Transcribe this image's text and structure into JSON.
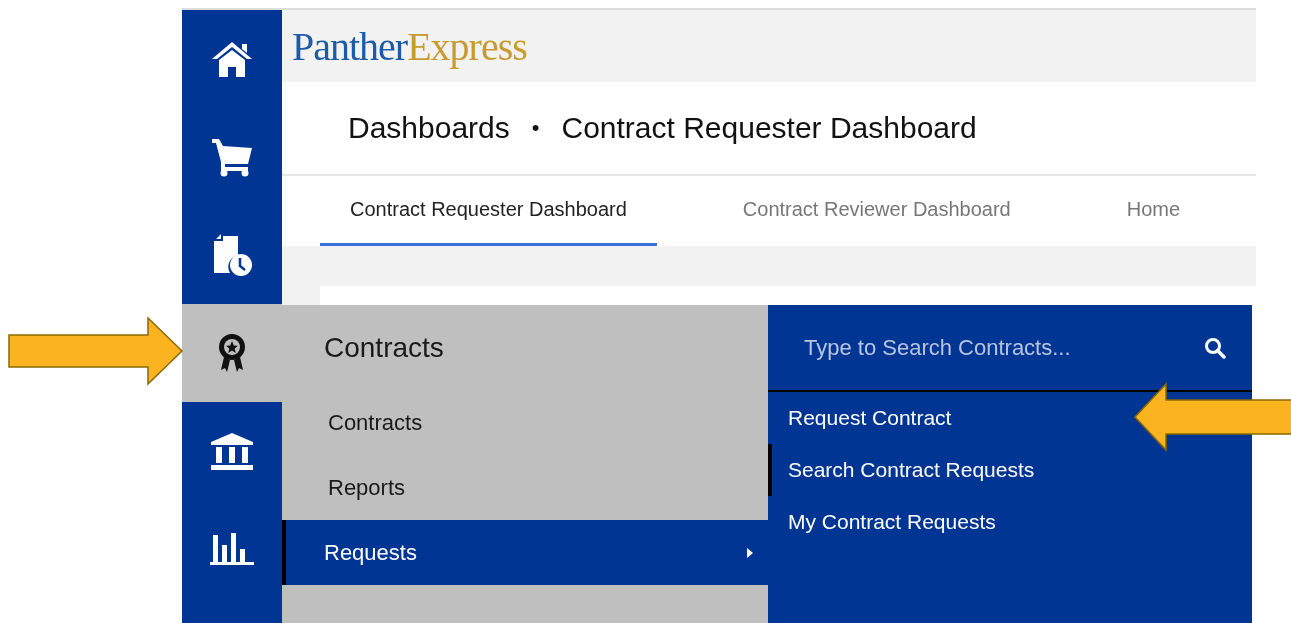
{
  "sidebar": {
    "items": [
      {
        "kind": "home",
        "selected": false
      },
      {
        "kind": "cart",
        "selected": false
      },
      {
        "kind": "document-clock",
        "selected": false
      },
      {
        "kind": "award",
        "selected": true
      },
      {
        "kind": "bank",
        "selected": false
      },
      {
        "kind": "chart",
        "selected": false
      }
    ]
  },
  "logo": {
    "parts": [
      {
        "text": "Panther",
        "color": "#1d5aa8"
      },
      {
        "text": "Express",
        "color": "#c89b2e"
      }
    ]
  },
  "breadcrumbs": {
    "items": [
      "Dashboards",
      "Contract Requester Dashboard"
    ],
    "separator": "•"
  },
  "tabs": [
    {
      "label": "Contract Requester Dashboard",
      "selected": true
    },
    {
      "label": "Contract Reviewer Dashboard",
      "selected": false
    },
    {
      "label": "Home",
      "selected": false
    }
  ],
  "menu": {
    "heading": "Contracts",
    "items": [
      {
        "label": "Contracts",
        "selected": false,
        "has_submenu": false
      },
      {
        "label": "Reports",
        "selected": false,
        "has_submenu": false
      },
      {
        "label": "Requests",
        "selected": true,
        "has_submenu": true
      }
    ]
  },
  "submenu": {
    "search": {
      "placeholder": "Type to Search Contracts..."
    },
    "items": [
      {
        "label": "Request Contract",
        "selected": false
      },
      {
        "label": "Search Contract Requests",
        "selected": true
      },
      {
        "label": "My Contract Requests",
        "selected": false
      }
    ]
  }
}
